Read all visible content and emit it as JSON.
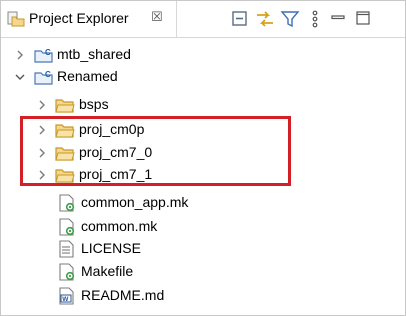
{
  "view": {
    "tab_title": "Project Explorer",
    "close_glyph": "☒"
  },
  "toolbar": {
    "icons": [
      "collapse-all-icon",
      "link-with-editor-icon",
      "filter-icon",
      "view-menu-icon",
      "minimize-icon",
      "maximize-icon"
    ]
  },
  "tree": {
    "items": [
      {
        "label": "mtb_shared",
        "icon": "project-icon",
        "state": "collapsed"
      },
      {
        "label": "Renamed",
        "icon": "project-icon",
        "state": "expanded"
      },
      {
        "label": "bsps",
        "icon": "folder-icon",
        "state": "collapsed"
      },
      {
        "label": "proj_cm0p",
        "icon": "folder-icon",
        "state": "collapsed"
      },
      {
        "label": "proj_cm7_0",
        "icon": "folder-icon",
        "state": "collapsed"
      },
      {
        "label": "proj_cm7_1",
        "icon": "folder-icon",
        "state": "collapsed"
      },
      {
        "label": "common_app.mk",
        "icon": "makefile-icon"
      },
      {
        "label": "common.mk",
        "icon": "makefile-icon"
      },
      {
        "label": "LICENSE",
        "icon": "text-file-icon"
      },
      {
        "label": "Makefile",
        "icon": "makefile-icon"
      },
      {
        "label": "README.md",
        "icon": "markdown-file-icon"
      }
    ]
  },
  "colors": {
    "highlight_border": "#d32027",
    "folder_fill": "#f5d68a",
    "folder_stroke": "#c49a2c"
  }
}
